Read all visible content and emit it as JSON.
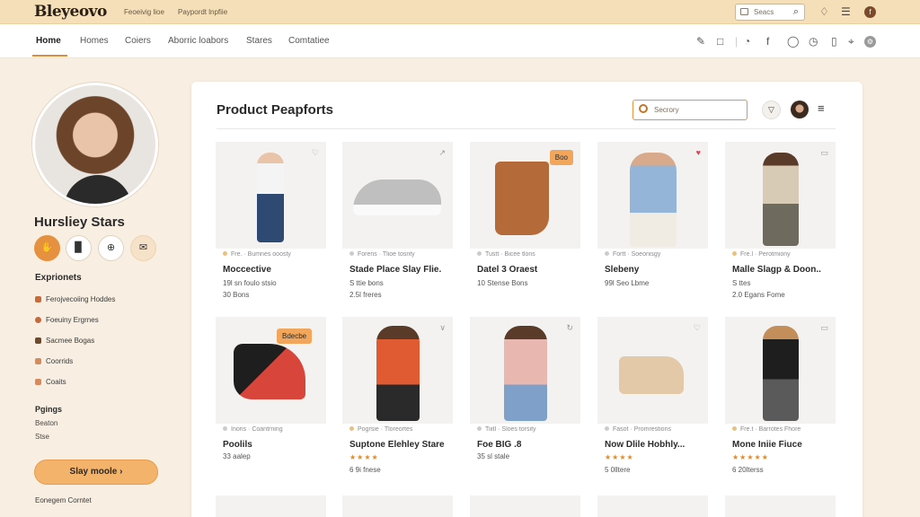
{
  "topbar": {
    "logo": "Bleyeovo",
    "links": [
      "Feoeivig lioe",
      "Paypordt lnpfiie"
    ],
    "search_placeholder": "Seacs"
  },
  "nav": {
    "items": [
      "Home",
      "Homes",
      "Coiers",
      "Aborric loabors",
      "Stares",
      "Comtatiee"
    ]
  },
  "sidebar": {
    "user_name": "Hursliey Stars",
    "section_1": "Exprionets",
    "menu": [
      "Ferojvecoiing Hoddes",
      "Foeuiny Ergrnes",
      "Sacmee Bogas",
      "Coorrids",
      "Coaits"
    ],
    "section_2": "Pgings",
    "sub_items": [
      "Beaton",
      "Stse"
    ],
    "cta": "Slay moole",
    "bottom_link": "Eonegem Corntet"
  },
  "panel": {
    "title": "Product Peapforts",
    "search_placeholder": "Secrory"
  },
  "products": [
    {
      "meta": "Fre. · Bumnes ooosty",
      "name": "Moccective",
      "line1": "19l sn foulo stsio",
      "line2": "30 Bons",
      "badge": "",
      "stars": ""
    },
    {
      "meta": "Forens · Tlioe tosnty",
      "name": "Stade Place Slay Flie.",
      "line1": "S ttie bons",
      "line2": "2.5l freres",
      "badge": "",
      "stars": ""
    },
    {
      "meta": "Tustt · Bicee tlons",
      "name": "Datel 3 Oraest",
      "line1": "10 Stense Bons",
      "line2": "",
      "badge": "Boo",
      "stars": ""
    },
    {
      "meta": "Fortt · Soeonisgy",
      "name": "Slebeny",
      "line1": "99l Seo Lbme",
      "line2": "",
      "badge": "",
      "stars": ""
    },
    {
      "meta": "Fre.l · Perotmiony",
      "name": "Malle Slagp & Doon..",
      "line1": "S ttes",
      "line2": "2.0 Egans Fome",
      "badge": "",
      "stars": ""
    },
    {
      "meta": "Inoris · Coantrning",
      "name": "Poolils",
      "line1": "33 aalep",
      "line2": "",
      "badge": "Bdecbe",
      "stars": ""
    },
    {
      "meta": "Pogrsie · Tloreortes",
      "name": "Suptone Elehley Stare",
      "line1": "",
      "line2": "6 9i fnese",
      "badge": "",
      "stars": "★★★★"
    },
    {
      "meta": "Tiiitl · Sloes torsity",
      "name": "Foe BIG .8",
      "line1": "35 sl stale",
      "line2": "",
      "badge": "",
      "stars": ""
    },
    {
      "meta": "Fasot · Promrestions",
      "name": "Now Dlile Hobhly...",
      "line1": "5 0lltere",
      "line2": "",
      "badge": "",
      "stars": "★★★★"
    },
    {
      "meta": "Fre.t · Barrotes Fhore",
      "name": "Mone Iniie Fiuce",
      "line1": "6 20lterss",
      "line2": "",
      "badge": "",
      "stars": "★★★★★"
    }
  ],
  "colors": {
    "accent": "#e6913f",
    "topbar": "#f4dfb9",
    "background": "#f8efe2"
  }
}
